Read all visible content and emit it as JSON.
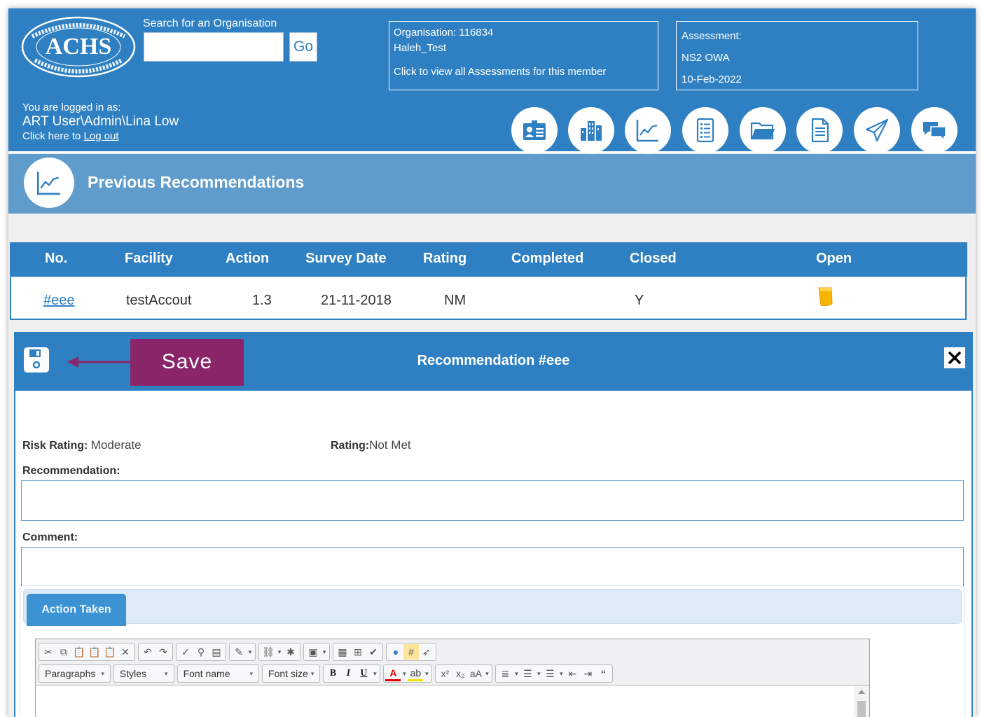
{
  "header": {
    "logo_text": "ACHS",
    "logo_ring_text": "THE AUSTRALIAN COUNCIL ON HEALTHCARE STANDARDS",
    "search_label": "Search for an Organisation",
    "search_value": "",
    "go_label": "Go",
    "login_label": "You are logged in as:",
    "login_user": "ART User\\Admin\\Lina Low",
    "logout_prefix": "Click here to ",
    "logout_link": "Log out",
    "organisation": {
      "line1": "Organisation: 116834",
      "line2": "Haleh_Test",
      "line3": "Click to view all Assessments for this member"
    },
    "assessment": {
      "line1": "Assessment:",
      "line2": "NS2 OWA",
      "line3": "10-Feb-2022"
    },
    "nav_icons": [
      "contact-card-icon",
      "buildings-icon",
      "line-chart-icon",
      "checklist-icon",
      "folder-icon",
      "document-icon",
      "paper-plane-icon",
      "chat-icon"
    ],
    "accent_color": "#2f80c2"
  },
  "page": {
    "title": "Previous Recommendations",
    "title_icon": "line-chart-icon"
  },
  "table": {
    "columns": [
      "No.",
      "Facility",
      "Action",
      "Survey Date",
      "Rating",
      "Completed",
      "Closed",
      "Open"
    ],
    "rows": [
      {
        "no": "#eee",
        "facility": "testAccout",
        "action": "1.3",
        "survey_date": "21-11-2018",
        "rating": "NM",
        "completed": "",
        "closed": "Y",
        "open_icon": "open-note-icon"
      }
    ]
  },
  "dialog": {
    "title": "Recommendation #eee",
    "annotation": "Save",
    "risk_rating_label": "Risk Rating:",
    "risk_rating_value": "Moderate",
    "rating_label": "Rating:",
    "rating_value": "Not Met",
    "recommendation_label": "Recommendation:",
    "recommendation_value": "",
    "comment_label": "Comment:",
    "comment_value": "",
    "tab_label": "Action Taken",
    "annotation_color": "#8a2569"
  },
  "editor": {
    "paragraphs_label": "Paragraphs",
    "styles_label": "Styles",
    "font_name_label": "Font name",
    "font_size_label": "Font size"
  }
}
